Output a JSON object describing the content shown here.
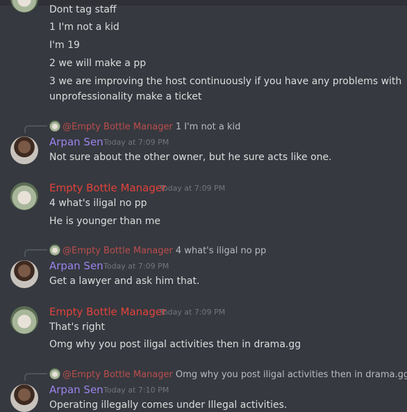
{
  "continuation": {
    "lines": [
      "Dont tag staff",
      "1 I'm not a kid",
      "I'm 19",
      "2 we will make a pp",
      "3 we are improving the host continuously if you have any problems with",
      "unprofessionality make a ticket"
    ]
  },
  "messages": [
    {
      "reply": {
        "mention": "@Empty Bottle Manager",
        "text": "1 I'm not a kid"
      },
      "author": "Arpan Sen",
      "timestamp": "Today at 7:09 PM",
      "lines": [
        "Not sure about the other owner, but he sure acts like one."
      ]
    },
    {
      "author": "Empty Bottle Manager",
      "timestamp": "Today at 7:09 PM",
      "lines": [
        "4 what's iligal no pp",
        "He is younger than me"
      ]
    },
    {
      "reply": {
        "mention": "@Empty Bottle Manager",
        "text": "4 what's iligal no pp"
      },
      "author": "Arpan Sen",
      "timestamp": "Today at 7:09 PM",
      "lines": [
        "Get a lawyer and ask him that."
      ]
    },
    {
      "author": "Empty Bottle Manager",
      "timestamp": "Today at 7:09 PM",
      "lines": [
        "That's right",
        "Omg why you post iligal activities then in drama.gg"
      ]
    },
    {
      "reply": {
        "mention": "@Empty Bottle Manager",
        "text": "Omg why you post iligal activities then in drama.gg"
      },
      "author": "Arpan Sen",
      "timestamp": "Today at 7:10 PM",
      "lines": [
        "Operating illegally comes under Illegal activities."
      ]
    }
  ]
}
